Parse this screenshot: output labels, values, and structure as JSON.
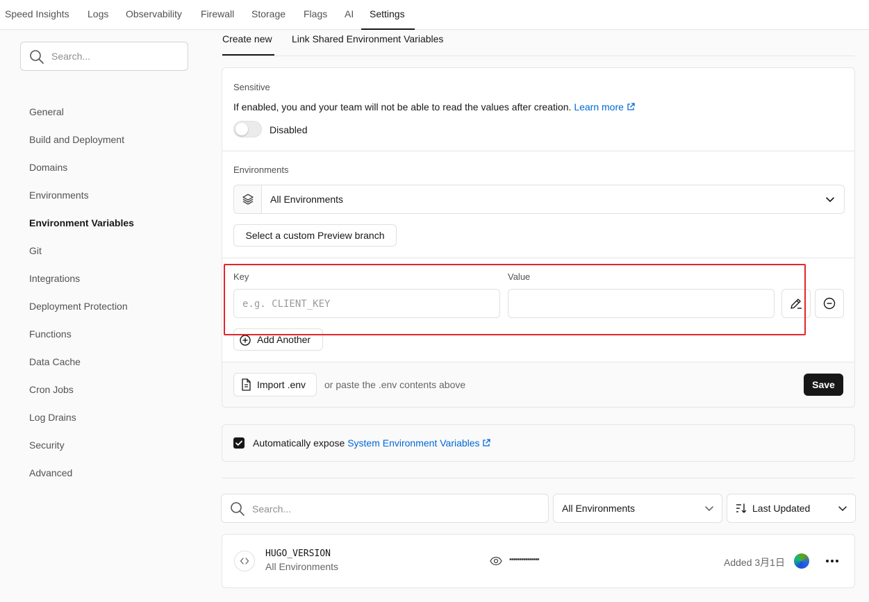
{
  "top_nav": {
    "tabs": [
      "Speed Insights",
      "Logs",
      "Observability",
      "Firewall",
      "Storage",
      "Flags",
      "AI",
      "Settings"
    ],
    "active": "Settings"
  },
  "sidebar": {
    "search_placeholder": "Search...",
    "items": [
      "General",
      "Build and Deployment",
      "Domains",
      "Environments",
      "Environment Variables",
      "Git",
      "Integrations",
      "Deployment Protection",
      "Functions",
      "Data Cache",
      "Cron Jobs",
      "Log Drains",
      "Security",
      "Advanced"
    ],
    "active": "Environment Variables"
  },
  "sub_tabs": {
    "create_new": "Create new",
    "link_shared": "Link Shared Environment Variables"
  },
  "form": {
    "sensitive": {
      "label": "Sensitive",
      "description": "If enabled, you and your team will not be able to read the values after creation.",
      "learn_more": "Learn more",
      "toggle_state": "Disabled"
    },
    "environments": {
      "label": "Environments",
      "selected": "All Environments",
      "custom_branch_button": "Select a custom Preview branch"
    },
    "key_label": "Key",
    "key_placeholder": "e.g. CLIENT_KEY",
    "key_value": "",
    "value_label": "Value",
    "value_value": "",
    "add_another": "Add Another",
    "import_button": "Import .env",
    "paste_hint": "or paste the .env contents above",
    "save": "Save"
  },
  "auto_expose": {
    "checked": true,
    "text": "Automatically expose",
    "link": "System Environment Variables"
  },
  "filters": {
    "search_placeholder": "Search...",
    "environment": "All Environments",
    "sort": "Last Updated"
  },
  "variables": [
    {
      "key": "HUGO_VERSION",
      "environments": "All Environments",
      "masked_value": "•••••••••••••••",
      "added": "Added 3月1日"
    }
  ],
  "colors": {
    "accent_link": "#0068d6",
    "highlight_box": "#e5242a",
    "primary_button": "#171717"
  }
}
